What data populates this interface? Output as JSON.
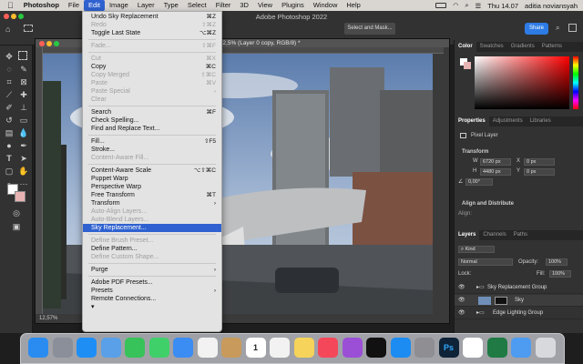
{
  "menubar": {
    "apple": "",
    "app": "Photoshop",
    "items": [
      "File",
      "Edit",
      "Image",
      "Layer",
      "Type",
      "Select",
      "Filter",
      "3D",
      "View",
      "Plugins",
      "Window",
      "Help"
    ],
    "clock": "Thu 14.07",
    "user": "aditia noviansyah"
  },
  "window": {
    "title": "Adobe Photoshop 2022"
  },
  "options": {
    "select_mask": "Select and Mask...",
    "share": "Share"
  },
  "document": {
    "title": "...2,5% (Layer 0 copy, RGB/8) *",
    "zoom": "12,57%"
  },
  "edit_menu": {
    "items": [
      {
        "label": "Undo Sky Replacement",
        "shortcut": "⌘Z",
        "disabled": false
      },
      {
        "label": "Redo",
        "shortcut": "⇧⌘Z",
        "disabled": true
      },
      {
        "label": "Toggle Last State",
        "shortcut": "⌥⌘Z",
        "disabled": false
      },
      {
        "sep": true
      },
      {
        "label": "Fade...",
        "shortcut": "⇧⌘F",
        "disabled": true
      },
      {
        "sep": true
      },
      {
        "label": "Cut",
        "shortcut": "⌘X",
        "disabled": true
      },
      {
        "label": "Copy",
        "shortcut": "⌘C",
        "disabled": false
      },
      {
        "label": "Copy Merged",
        "shortcut": "⇧⌘C",
        "disabled": true
      },
      {
        "label": "Paste",
        "shortcut": "⌘V",
        "disabled": true
      },
      {
        "label": "Paste Special",
        "shortcut": "›",
        "disabled": true
      },
      {
        "label": "Clear",
        "shortcut": "",
        "disabled": true
      },
      {
        "sep": true
      },
      {
        "label": "Search",
        "shortcut": "⌘F",
        "disabled": false
      },
      {
        "label": "Check Spelling...",
        "shortcut": "",
        "disabled": false
      },
      {
        "label": "Find and Replace Text...",
        "shortcut": "",
        "disabled": false
      },
      {
        "sep": true
      },
      {
        "label": "Fill...",
        "shortcut": "⇧F5",
        "disabled": false
      },
      {
        "label": "Stroke...",
        "shortcut": "",
        "disabled": false
      },
      {
        "label": "Content-Aware Fill...",
        "shortcut": "",
        "disabled": true
      },
      {
        "sep": true
      },
      {
        "label": "Content-Aware Scale",
        "shortcut": "⌥⇧⌘C",
        "disabled": false
      },
      {
        "label": "Puppet Warp",
        "shortcut": "",
        "disabled": false
      },
      {
        "label": "Perspective Warp",
        "shortcut": "",
        "disabled": false
      },
      {
        "label": "Free Transform",
        "shortcut": "⌘T",
        "disabled": false
      },
      {
        "label": "Transform",
        "shortcut": "›",
        "disabled": false
      },
      {
        "label": "Auto-Align Layers...",
        "shortcut": "",
        "disabled": true
      },
      {
        "label": "Auto-Blend Layers...",
        "shortcut": "",
        "disabled": true
      },
      {
        "label": "Sky Replacement...",
        "shortcut": "",
        "disabled": false,
        "highlight": true
      },
      {
        "sep": true
      },
      {
        "label": "Define Brush Preset...",
        "shortcut": "",
        "disabled": true
      },
      {
        "label": "Define Pattern...",
        "shortcut": "",
        "disabled": false
      },
      {
        "label": "Define Custom Shape...",
        "shortcut": "",
        "disabled": true
      },
      {
        "sep": true
      },
      {
        "label": "Purge",
        "shortcut": "›",
        "disabled": false
      },
      {
        "sep": true
      },
      {
        "label": "Adobe PDF Presets...",
        "shortcut": "",
        "disabled": false
      },
      {
        "label": "Presets",
        "shortcut": "›",
        "disabled": false
      },
      {
        "label": "Remote Connections...",
        "shortcut": "",
        "disabled": false
      },
      {
        "label": "▾",
        "shortcut": "",
        "disabled": false
      }
    ]
  },
  "color_panel": {
    "tabs": [
      "Color",
      "Swatches",
      "Gradients",
      "Patterns"
    ]
  },
  "properties_panel": {
    "tabs": [
      "Properties",
      "Adjustments",
      "Libraries"
    ],
    "layer_type": "Pixel Layer",
    "transform_label": "Transform",
    "w": "6720 px",
    "x": "0 px",
    "h": "4480 px",
    "y": "0 px",
    "angle": "0,00°",
    "align_label": "Align and Distribute",
    "align_sub": "Align:"
  },
  "layers_panel": {
    "tabs": [
      "Layers",
      "Channels",
      "Paths"
    ],
    "kind": "Kind",
    "blend": "Normal",
    "opacity_label": "Opacity:",
    "opacity": "100%",
    "lock_label": "Lock:",
    "fill_label": "Fill:",
    "fill": "100%",
    "layers": [
      "Sky Replacement Group",
      "Sky",
      "Edge Lighting Group"
    ]
  },
  "dock": {
    "icons": [
      "finder-icon",
      "launchpad-icon",
      "safari-icon",
      "preview-icon",
      "facetime-icon",
      "messages-icon",
      "mail-icon",
      "photos-icon",
      "contacts-icon",
      "calendar-icon",
      "reminders-icon",
      "notes-icon",
      "music-icon",
      "podcasts-icon",
      "appletv-icon",
      "appstore-icon",
      "settings-icon",
      "photoshop-icon",
      "chrome-icon",
      "excel-icon",
      "downloads-icon",
      "trash-icon"
    ],
    "calendar_day": "1",
    "ps_label": "Ps"
  },
  "colors": {
    "accent": "#2f62d0",
    "share": "#2d7ce5"
  }
}
